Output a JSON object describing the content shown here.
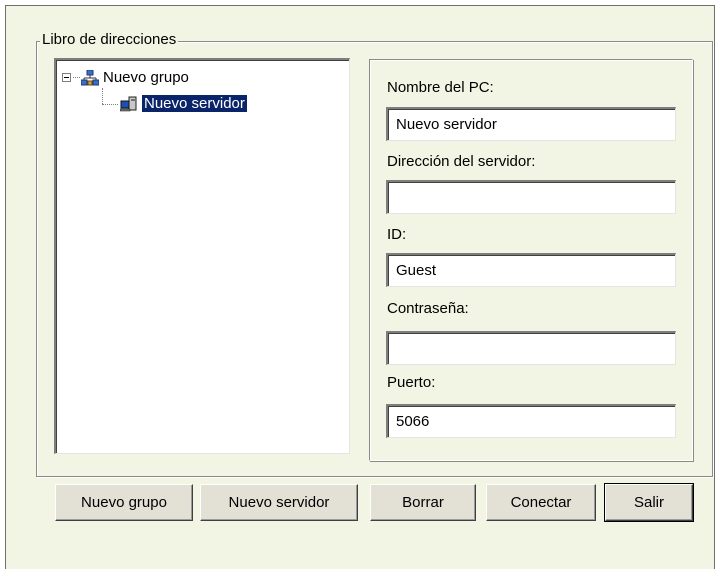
{
  "addressbook": {
    "title": "Libro de direcciones"
  },
  "tree": {
    "group": {
      "label": "Nuevo grupo",
      "icon": "network-group-icon",
      "expanded": true
    },
    "server": {
      "label": "Nuevo servidor",
      "icon": "computer-icon",
      "selected": true
    }
  },
  "form": {
    "pc_name_label": "Nombre del PC:",
    "pc_name_value": "Nuevo servidor",
    "server_address_label": "Dirección del servidor:",
    "server_address_value": "",
    "id_label": "ID:",
    "id_value": "Guest",
    "password_label": "Contraseña:",
    "password_value": "",
    "port_label": "Puerto:",
    "port_value": "5066"
  },
  "buttons": {
    "new_group": "Nuevo grupo",
    "new_server": "Nuevo servidor",
    "delete": "Borrar",
    "connect": "Conectar",
    "exit": "Salir"
  },
  "colors": {
    "window_bg": "#f2f5e3",
    "selection_bg": "#0a246a",
    "button_bg": "#e3e0d6"
  }
}
